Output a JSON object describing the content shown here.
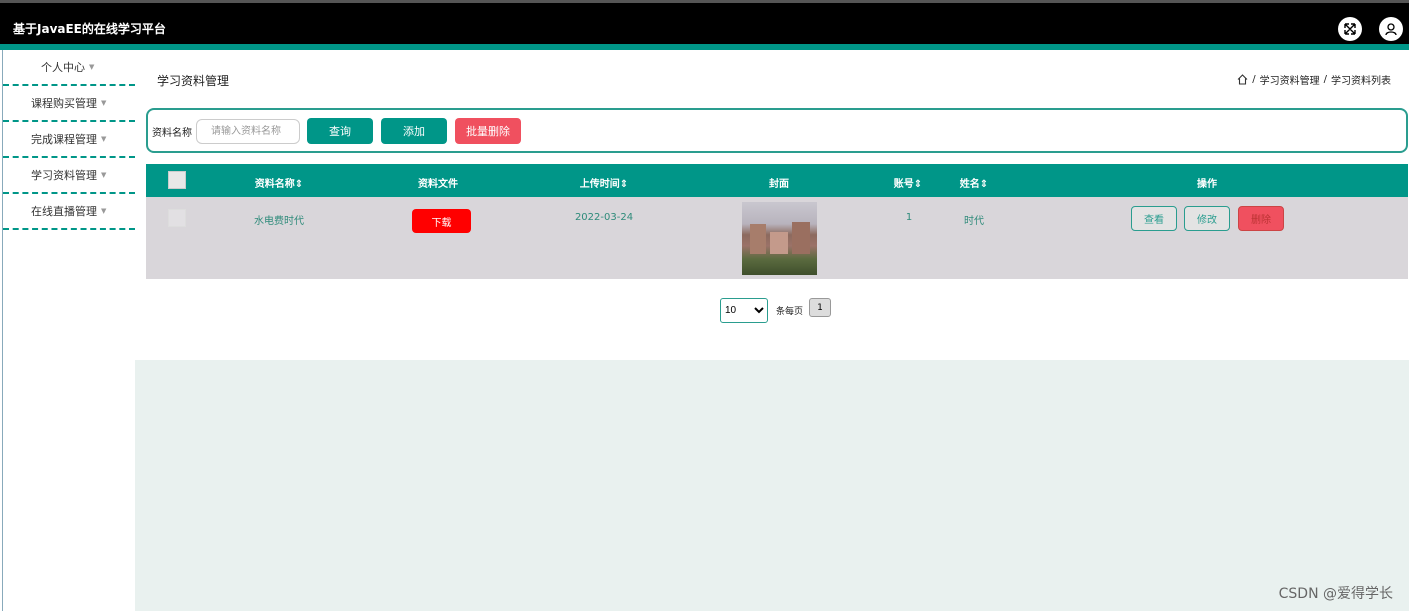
{
  "header": {
    "title": "基于JavaEE的在线学习平台"
  },
  "sidebar": {
    "items": [
      {
        "label": "个人中心"
      },
      {
        "label": "课程购买管理"
      },
      {
        "label": "完成课程管理"
      },
      {
        "label": "学习资料管理"
      },
      {
        "label": "在线直播管理"
      }
    ]
  },
  "page": {
    "title": "学习资料管理",
    "breadcrumb": [
      "学习资料管理",
      "学习资料列表"
    ],
    "breadcrumb_sep": "/"
  },
  "search": {
    "label": "资料名称",
    "placeholder": "请输入资料名称",
    "query_label": "查询",
    "add_label": "添加",
    "batch_delete_label": "批量删除"
  },
  "table": {
    "columns": {
      "name": "资料名称",
      "file": "资料文件",
      "upload_time": "上传时间",
      "cover": "封面",
      "account": "账号",
      "realname": "姓名",
      "actions": "操作"
    },
    "rows": [
      {
        "name": "水电费时代",
        "download_label": "下载",
        "upload_time": "2022-03-24",
        "account": "1",
        "realname": "时代",
        "view_label": "查看",
        "edit_label": "修改",
        "delete_label": "删除"
      }
    ]
  },
  "pagination": {
    "page_size": "10",
    "per_page_label": "条每页",
    "current_page": "1"
  },
  "watermark": "CSDN @爱得学长",
  "colors": {
    "accent": "#009688",
    "danger": "#f0505f",
    "download": "#ff0000",
    "topbar": "#000000"
  }
}
